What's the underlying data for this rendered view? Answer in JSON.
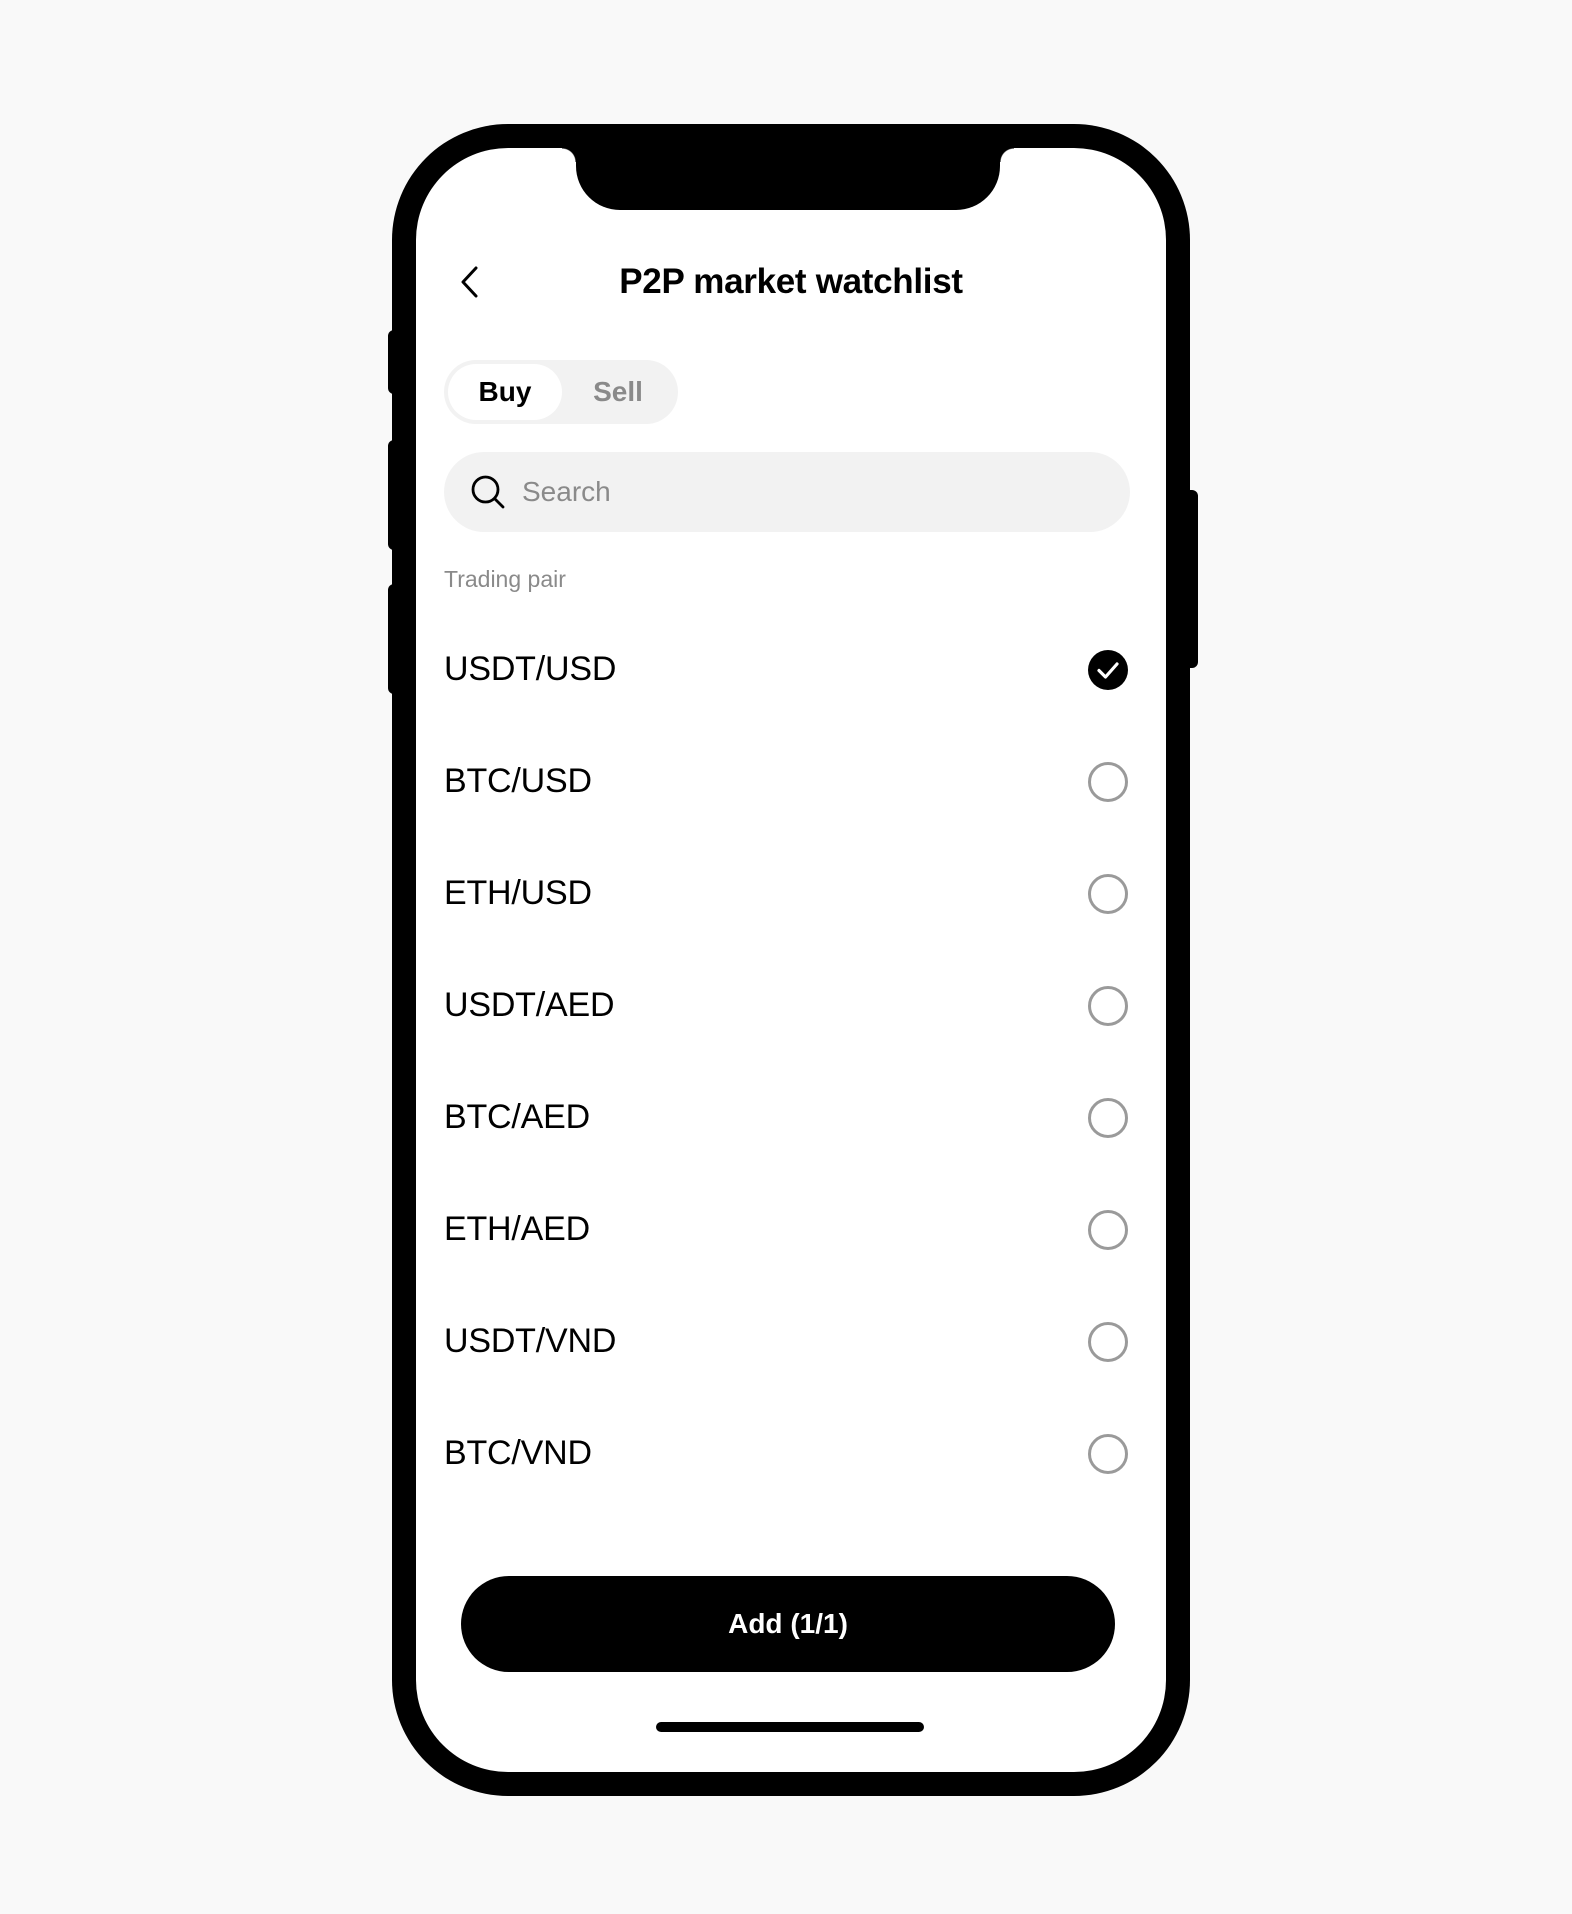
{
  "header": {
    "title": "P2P market watchlist",
    "back_icon": "chevron-left-icon"
  },
  "toggle": {
    "buy_label": "Buy",
    "sell_label": "Sell",
    "selected": "Buy"
  },
  "search": {
    "placeholder": "Search",
    "value": "",
    "icon": "search-icon"
  },
  "list": {
    "section_label": "Trading pair",
    "items": [
      {
        "label": "USDT/USD",
        "checked": true
      },
      {
        "label": "BTC/USD",
        "checked": false
      },
      {
        "label": "ETH/USD",
        "checked": false
      },
      {
        "label": "USDT/AED",
        "checked": false
      },
      {
        "label": "BTC/AED",
        "checked": false
      },
      {
        "label": "ETH/AED",
        "checked": false
      },
      {
        "label": "USDT/VND",
        "checked": false
      },
      {
        "label": "BTC/VND",
        "checked": false
      }
    ]
  },
  "footer": {
    "add_label": "Add (1/1)"
  },
  "colors": {
    "background": "#f9f9f9",
    "phone_frame": "#000000",
    "screen": "#ffffff",
    "muted_text": "#8a8a8a",
    "control_bg": "#f2f2f2",
    "primary_button": "#000000"
  }
}
